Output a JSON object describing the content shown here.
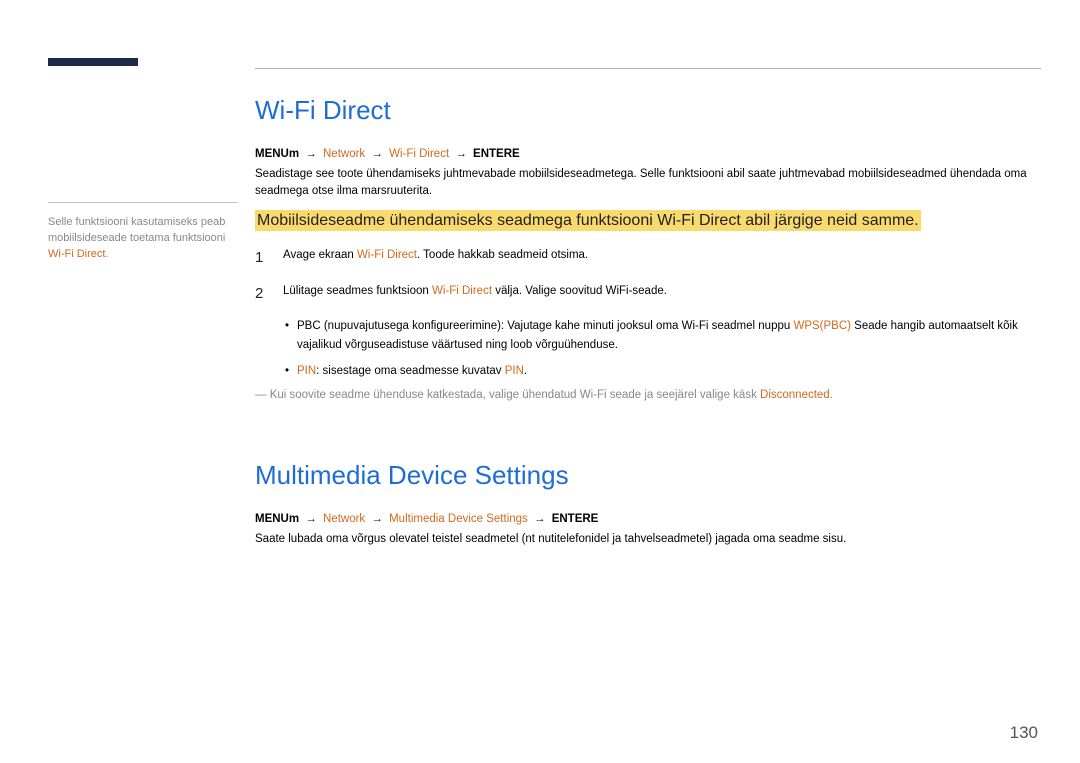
{
  "side_note": {
    "pre": "Selle funktsiooni kasutamiseks peab mobiilsideseade toetama funktsiooni ",
    "term": "Wi-Fi Direct",
    "post": "."
  },
  "sec1": {
    "title": "Wi-Fi Direct",
    "path_menu": "MENUm",
    "path_network": "Network",
    "path_feature": "Wi-Fi Direct",
    "path_enter": "ENTERE",
    "arrow": "→",
    "desc": "Seadistage see toote ühendamiseks juhtmevabade mobiilsideseadmetega. Selle funktsiooni abil saate juhtmevabad mobiilsideseadmed ühendada oma seadmega otse ilma marsruuterita.",
    "highlight": "Mobiilsideseadme ühendamiseks seadmega funktsiooni Wi-Fi Direct abil järgige neid samme.",
    "step1_num": "1",
    "step1_pre": "Avage ekraan ",
    "step1_term": "Wi-Fi Direct",
    "step1_post": ". Toode hakkab seadmeid otsima.",
    "step2_num": "2",
    "step2_pre": "Lülitage seadmes funktsioon ",
    "step2_term": "Wi-Fi Direct",
    "step2_post": " välja. Valige soovitud WiFi-seade.",
    "bullet1_pre": "PBC (nupuvajutusega konfigureerimine): Vajutage kahe minuti jooksul oma Wi-Fi seadmel nuppu ",
    "bullet1_term": "WPS(PBC)",
    "bullet1_post": " Seade hangib automaatselt kõik vajalikud võrguseadistuse väärtused ning loob võrguühenduse.",
    "bullet2_term1": "PIN",
    "bullet2_pre": ": sisestage oma seadmesse kuvatav ",
    "bullet2_term2": "PIN",
    "bullet2_post": ".",
    "fn_dash": "―",
    "fn_pre": " Kui soovite seadme ühenduse katkestada, valige ühendatud Wi-Fi seade ja seejärel valige käsk ",
    "fn_term": "Disconnected",
    "fn_post": "."
  },
  "sec2": {
    "title": "Multimedia Device Settings",
    "path_menu": "MENUm",
    "path_network": "Network",
    "path_feature": "Multimedia Device Settings",
    "path_enter": "ENTERE",
    "arrow": "→",
    "desc": "Saate lubada oma võrgus olevatel teistel seadmetel (nt nutitelefonidel ja tahvelseadmetel) jagada oma seadme sisu."
  },
  "page_number": "130"
}
